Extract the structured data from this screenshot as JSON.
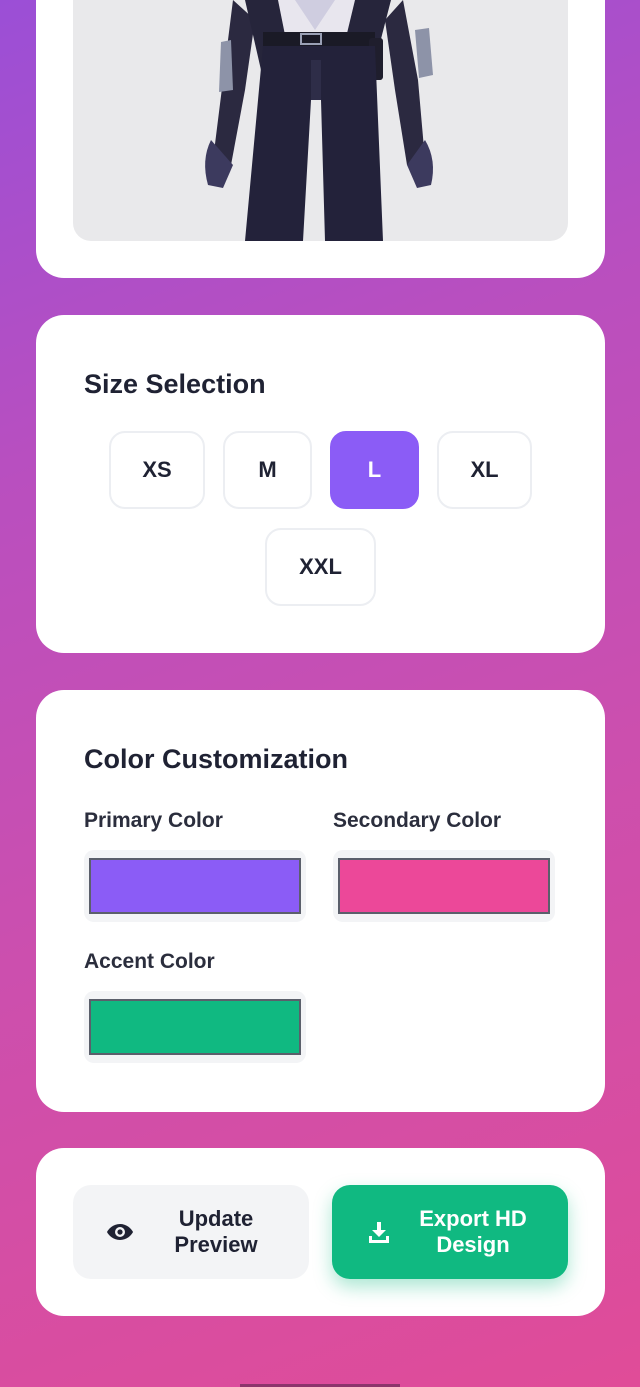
{
  "size_section": {
    "title": "Size Selection",
    "sizes": [
      "XS",
      "M",
      "L",
      "XL",
      "XXL"
    ],
    "selected": "L"
  },
  "color_section": {
    "title": "Color Customization",
    "primary": {
      "label": "Primary Color",
      "value": "#8b5cf6"
    },
    "secondary": {
      "label": "Secondary Color",
      "value": "#ec4899"
    },
    "accent": {
      "label": "Accent Color",
      "value": "#10b981"
    }
  },
  "actions": {
    "update": {
      "line1": "Update",
      "line2": "Preview",
      "icon": "eye-icon"
    },
    "export": {
      "line1": "Export HD",
      "line2": "Design",
      "icon": "download-icon"
    }
  },
  "colors": {
    "accent_purple": "#8b5cf6",
    "export_green": "#10b981"
  }
}
